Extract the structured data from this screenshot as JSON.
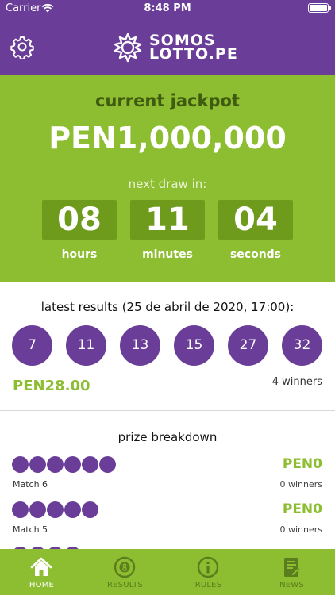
{
  "status_bar": {
    "carrier": "Carrier",
    "time": "8:48 PM"
  },
  "header": {
    "logo_line1": "SOMOS",
    "logo_line2": "LOTTO.PE",
    "settings_icon": "gear-icon"
  },
  "jackpot": {
    "label": "current jackpot",
    "amount": "PEN1,000,000",
    "next_draw_label": "next draw in:",
    "countdown": [
      {
        "value": "08",
        "label": "hours"
      },
      {
        "value": "11",
        "label": "minutes"
      },
      {
        "value": "04",
        "label": "seconds"
      }
    ]
  },
  "latest_results": {
    "title": "latest results (25 de abril de 2020, 17:00):",
    "numbers": [
      "7",
      "11",
      "13",
      "15",
      "27",
      "32"
    ],
    "prize": "PEN28.00",
    "winners": "4 winners"
  },
  "breakdown": {
    "title": "prize breakdown",
    "rows": [
      {
        "match": "Match 6",
        "balls": 6,
        "prize": "PEN0",
        "winners": "0 winners"
      },
      {
        "match": "Match 5",
        "balls": 5,
        "prize": "PEN0",
        "winners": "0 winners"
      }
    ]
  },
  "tabs": [
    {
      "label": "HOME",
      "icon": "home-icon",
      "active": true
    },
    {
      "label": "RESULTS",
      "icon": "lottery-ball-icon",
      "active": false
    },
    {
      "label": "RULES",
      "icon": "info-icon",
      "active": false
    },
    {
      "label": "NEWS",
      "icon": "news-icon",
      "active": false
    }
  ],
  "colors": {
    "purple": "#6a3d98",
    "green": "#8dbd30",
    "dark_green": "#6f9b1d"
  }
}
